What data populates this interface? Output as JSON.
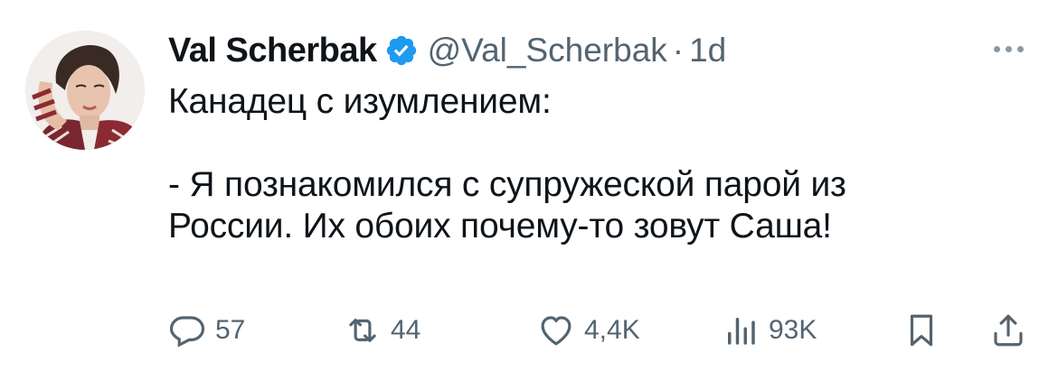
{
  "author": {
    "name": "Val Scherbak",
    "handle": "@Val_Scherbak",
    "separator": "·",
    "time": "1d",
    "verified_color": "#1d9bf0"
  },
  "tweet": {
    "lines": [
      "Канадец с изумлением:",
      "",
      "- Я познакомился с супружеской парой из",
      "России. Их обоих почему-то зовут Саша!"
    ]
  },
  "actions": {
    "replies": "57",
    "retweets": "44",
    "likes": "4,4K",
    "views": "93K"
  },
  "icons": [
    "more-icon",
    "verified-badge-icon",
    "reply-icon",
    "retweet-icon",
    "like-icon",
    "views-icon",
    "bookmark-icon",
    "share-icon"
  ]
}
